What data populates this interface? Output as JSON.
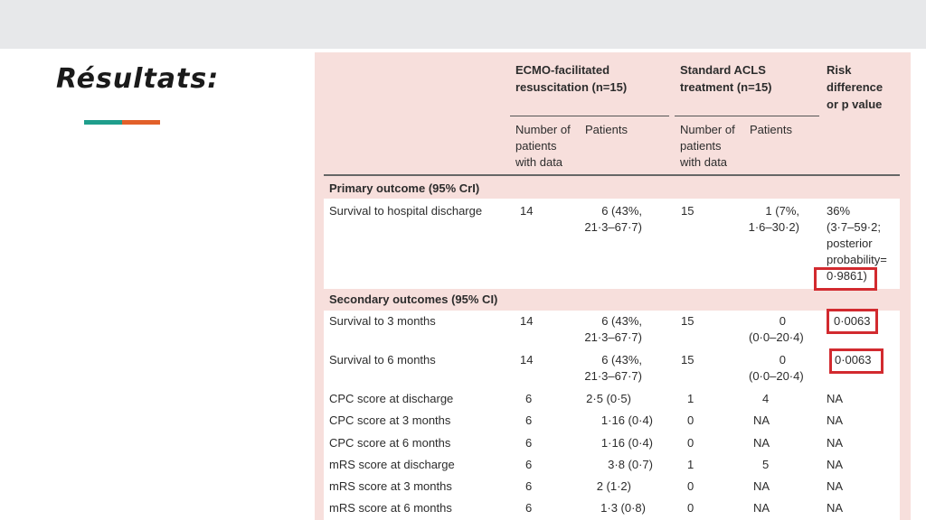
{
  "slide": {
    "title": "Résultats:",
    "accent_colors": [
      "#1f9e8c",
      "#e2602a"
    ],
    "highlight_color": "#d22a2f"
  },
  "table": {
    "group_headers": [
      [
        "ECMO-facilitated",
        "resuscitation (n=15)"
      ],
      [
        "Standard ACLS",
        "treatment (n=15)"
      ],
      [
        "Risk",
        "difference",
        "or p value"
      ]
    ],
    "sub_headers": {
      "number_with_data": [
        "Number of",
        "patients",
        "with data"
      ],
      "patients": "Patients"
    },
    "sections": {
      "primary": "Primary outcome (95% CrI)",
      "secondary": "Secondary outcomes (95% CI)"
    },
    "rows": [
      {
        "label": "Survival to hospital discharge",
        "ecmo_n": "14",
        "ecmo_pat": [
          "6 (43%,",
          "21·3–67·7)"
        ],
        "std_n": "15",
        "std_pat": [
          "1 (7%,",
          "1·6–30·2)"
        ],
        "risk": [
          "36%",
          "(3·7–59·2;",
          "posterior",
          "probability=",
          "0·9861)"
        ]
      },
      {
        "label": "Survival to 3 months",
        "ecmo_n": "14",
        "ecmo_pat": [
          "6 (43%,",
          "21·3–67·7)"
        ],
        "std_n": "15",
        "std_pat": [
          "0",
          "(0·0–20·4)"
        ],
        "risk": [
          "0·0063"
        ]
      },
      {
        "label": "Survival to 6 months",
        "ecmo_n": "14",
        "ecmo_pat": [
          "6 (43%,",
          "21·3–67·7)"
        ],
        "std_n": "15",
        "std_pat": [
          "0",
          "(0·0–20·4)"
        ],
        "risk": [
          "0·0063"
        ]
      },
      {
        "label": "CPC score at discharge",
        "ecmo_n": "6",
        "ecmo_pat": [
          "2·5 (0·5)"
        ],
        "std_n": "1",
        "std_pat": [
          "4"
        ],
        "risk": [
          "NA"
        ]
      },
      {
        "label": "CPC score at 3 months",
        "ecmo_n": "6",
        "ecmo_pat": [
          "1·16 (0·4)"
        ],
        "std_n": "0",
        "std_pat": [
          "NA"
        ],
        "risk": [
          "NA"
        ]
      },
      {
        "label": "CPC score at 6 months",
        "ecmo_n": "6",
        "ecmo_pat": [
          "1·16 (0·4)"
        ],
        "std_n": "0",
        "std_pat": [
          "NA"
        ],
        "risk": [
          "NA"
        ]
      },
      {
        "label": "mRS score at discharge",
        "ecmo_n": "6",
        "ecmo_pat": [
          "3·8 (0·7)"
        ],
        "std_n": "1",
        "std_pat": [
          "5"
        ],
        "risk": [
          "NA"
        ]
      },
      {
        "label": "mRS score at 3 months",
        "ecmo_n": "6",
        "ecmo_pat": [
          "2 (1·2)"
        ],
        "std_n": "0",
        "std_pat": [
          "NA"
        ],
        "risk": [
          "NA"
        ]
      },
      {
        "label": "mRS score at 6 months",
        "ecmo_n": "6",
        "ecmo_pat": [
          "1·3 (0·8)"
        ],
        "std_n": "0",
        "std_pat": [
          "NA"
        ],
        "risk": [
          "NA"
        ]
      }
    ]
  }
}
